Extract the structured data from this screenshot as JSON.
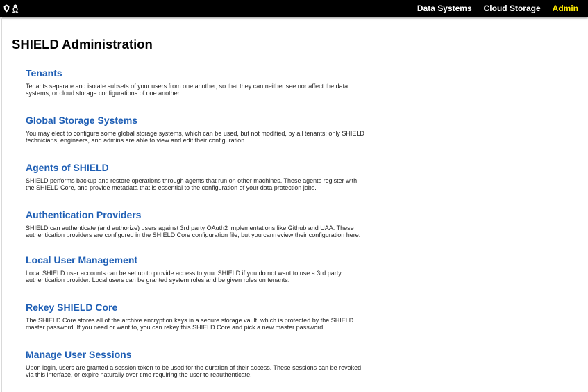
{
  "header": {
    "logo_icons": [
      "shield-logo-icon",
      "linux-penguin-icon"
    ],
    "nav": [
      {
        "label": "Data Systems",
        "active": false
      },
      {
        "label": "Cloud Storage",
        "active": false
      },
      {
        "label": "Admin",
        "active": true
      }
    ],
    "colors": {
      "bar": "#000000",
      "link": "#ffffff",
      "active_link": "#ffeb00"
    }
  },
  "main": {
    "title": "SHIELD Administration",
    "sections": [
      {
        "title": "Tenants",
        "description": "Tenants separate and isolate subsets of your users from one another, so that they can neither see nor affect the data systems, or cloud storage configurations of one another."
      },
      {
        "title": "Global Storage Systems",
        "description": "You may elect to configure some global storage systems, which can be used, but not modified, by all tenants; only SHIELD technicians, engineers, and admins are able to view and edit their configuration."
      },
      {
        "title": "Agents of SHIELD",
        "description": "SHIELD performs backup and restore operations through agents that run on other machines. These agents register with the SHIELD Core, and provide metadata that is essential to the configuration of your data protection jobs."
      },
      {
        "title": "Authentication Providers",
        "description": "SHIELD can authenticate (and authorize) users against 3rd party OAuth2 implementations like Github and UAA. These authentication providers are configured in the SHIELD Core configuration file, but you can review their configuration here."
      },
      {
        "title": "Local User Management",
        "description": "Local SHIELD user accounts can be set up to provide access to your SHIELD if you do not want to use a 3rd party authentication provider. Local users can be granted system roles and be given roles on tenants."
      },
      {
        "title": "Rekey SHIELD Core",
        "description": "The SHIELD Core stores all of the archive encryption keys in a secure storage vault, which is protected by the SHIELD master password. If you need or want to, you can rekey this SHIELD Core and pick a new master password."
      },
      {
        "title": "Manage User Sessions",
        "description": "Upon login, users are granted a session token to be used for the duration of their access. These sessions can be revoked via this interface, or expire naturally over time requiring the user to reauthenticate."
      }
    ],
    "colors": {
      "section_title": "#1f5fb5"
    }
  }
}
